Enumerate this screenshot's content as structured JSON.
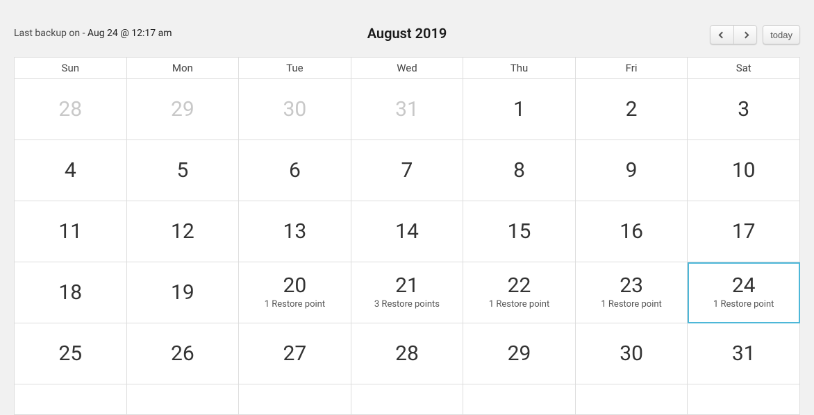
{
  "header": {
    "last_backup_prefix": "Last backup on - ",
    "last_backup_date": "Aug 24 @ 12:17 am",
    "month_title": "August 2019",
    "today_label": "today"
  },
  "day_headers": [
    "Sun",
    "Mon",
    "Tue",
    "Wed",
    "Thu",
    "Fri",
    "Sat"
  ],
  "weeks": [
    [
      {
        "d": "28",
        "other": true
      },
      {
        "d": "29",
        "other": true
      },
      {
        "d": "30",
        "other": true
      },
      {
        "d": "31",
        "other": true
      },
      {
        "d": "1"
      },
      {
        "d": "2"
      },
      {
        "d": "3"
      }
    ],
    [
      {
        "d": "4"
      },
      {
        "d": "5"
      },
      {
        "d": "6"
      },
      {
        "d": "7"
      },
      {
        "d": "8"
      },
      {
        "d": "9"
      },
      {
        "d": "10"
      }
    ],
    [
      {
        "d": "11"
      },
      {
        "d": "12"
      },
      {
        "d": "13"
      },
      {
        "d": "14"
      },
      {
        "d": "15"
      },
      {
        "d": "16"
      },
      {
        "d": "17"
      }
    ],
    [
      {
        "d": "18"
      },
      {
        "d": "19"
      },
      {
        "d": "20",
        "restore": "1 Restore point"
      },
      {
        "d": "21",
        "restore": "3 Restore points"
      },
      {
        "d": "22",
        "restore": "1 Restore point"
      },
      {
        "d": "23",
        "restore": "1 Restore point"
      },
      {
        "d": "24",
        "restore": "1 Restore point",
        "selected": true
      }
    ],
    [
      {
        "d": "25"
      },
      {
        "d": "26"
      },
      {
        "d": "27"
      },
      {
        "d": "28"
      },
      {
        "d": "29"
      },
      {
        "d": "30"
      },
      {
        "d": "31"
      }
    ],
    [
      {
        "d": ""
      },
      {
        "d": ""
      },
      {
        "d": ""
      },
      {
        "d": ""
      },
      {
        "d": ""
      },
      {
        "d": ""
      },
      {
        "d": ""
      }
    ]
  ]
}
